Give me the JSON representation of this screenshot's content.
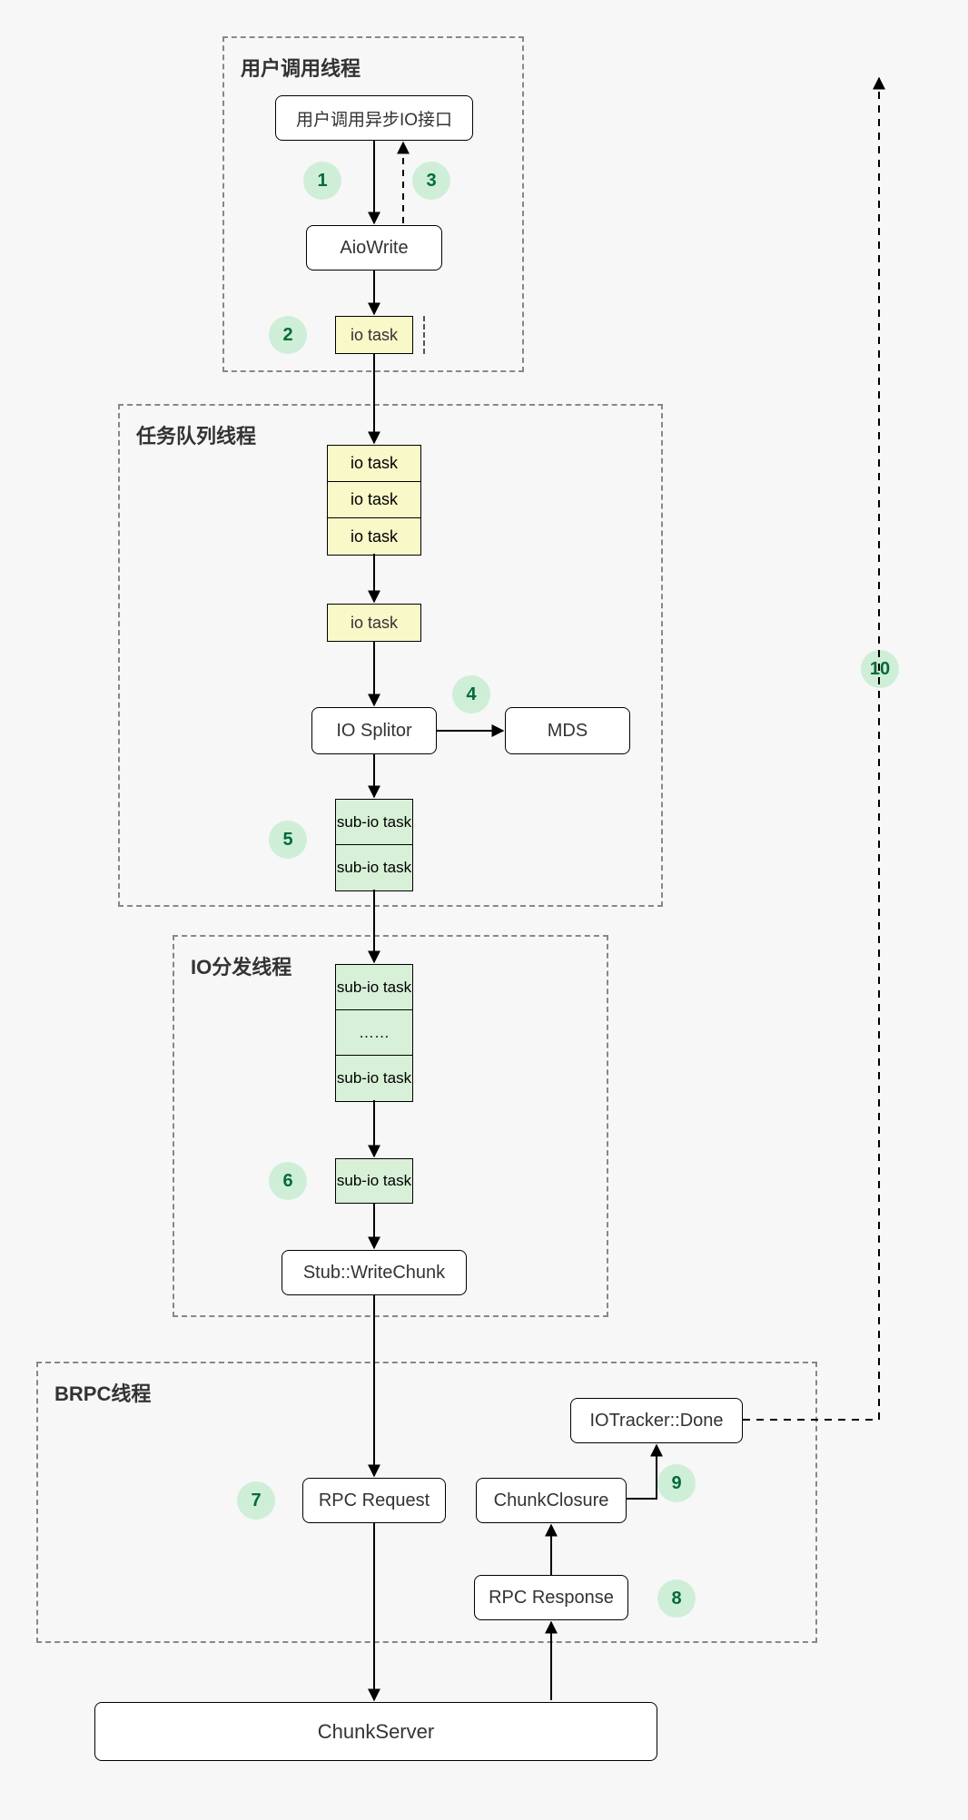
{
  "groups": {
    "user": "用户调用线程",
    "queue": "任务队列线程",
    "io": "IO分发线程",
    "brpc": "BRPC线程"
  },
  "nodes": {
    "userCall": "用户调用异步IO接口",
    "aioWrite": "AioWrite",
    "ioTaskA": "io task",
    "queueRow1": "io task",
    "queueRow2": "io task",
    "queueRow3": "io task",
    "ioTaskB": "io task",
    "ioSplitor": "IO Splitor",
    "mds": "MDS",
    "subA1": "sub-io task",
    "subA2": "sub-io task",
    "subB1": "sub-io task",
    "subB2": "……",
    "subB3": "sub-io task",
    "subC": "sub-io task",
    "stubWrite": "Stub::WriteChunk",
    "rpcReq": "RPC Request",
    "chunkClosure": "ChunkClosure",
    "rpcResp": "RPC Response",
    "ioTracker": "IOTracker::Done",
    "chunkServer": "ChunkServer"
  },
  "steps": {
    "s1": "1",
    "s2": "2",
    "s3": "3",
    "s4": "4",
    "s5": "5",
    "s6": "6",
    "s7": "7",
    "s8": "8",
    "s9": "9",
    "s10": "10"
  }
}
